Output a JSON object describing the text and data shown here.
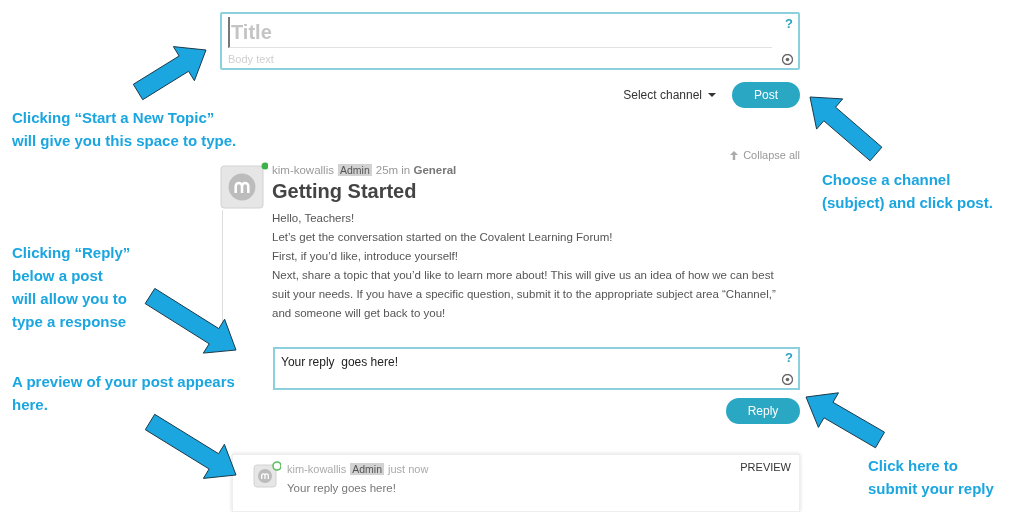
{
  "compose": {
    "title_placeholder": "Title",
    "body_placeholder": "Body text",
    "help": "?"
  },
  "channel_select": {
    "label": "Select channel"
  },
  "post_button": "Post",
  "collapse_all": "Collapse all",
  "post": {
    "author": "kim-kowallis",
    "badge": "Admin",
    "time": "25m in **General**",
    "title": "Getting Started",
    "body": [
      "Hello, Teachers!",
      "Let’s get the conversation started on the Covalent Learning Forum!",
      "First, if you’d like, introduce yourself!",
      "Next, share a topic that you’d like to learn more about! This will give us an idea of how we can best suit your needs. If you have a specific question, submit it to the appropriate subject area “Channel,” and someone will get back to you!"
    ]
  },
  "reply_box": {
    "value": "Your reply  goes here!",
    "help": "?"
  },
  "reply_button": "Reply",
  "preview": {
    "author": "kim-kowallis",
    "badge": "Admin",
    "time": "just now",
    "label": "PREVIEW",
    "text": "Your reply goes here!"
  },
  "annotations": [
    {
      "lines": [
        "Clicking “Start a New Topic”",
        "will give you this space to type."
      ]
    },
    {
      "lines": [
        "Choose a channel",
        "(subject) and click post."
      ]
    },
    {
      "lines": [
        "Clicking “Reply”",
        "below a post",
        "will allow you to",
        "type a response"
      ]
    },
    {
      "lines": [
        "A preview of your post appears",
        "here."
      ]
    },
    {
      "lines": [
        "Click here to",
        "submit your reply"
      ]
    }
  ]
}
